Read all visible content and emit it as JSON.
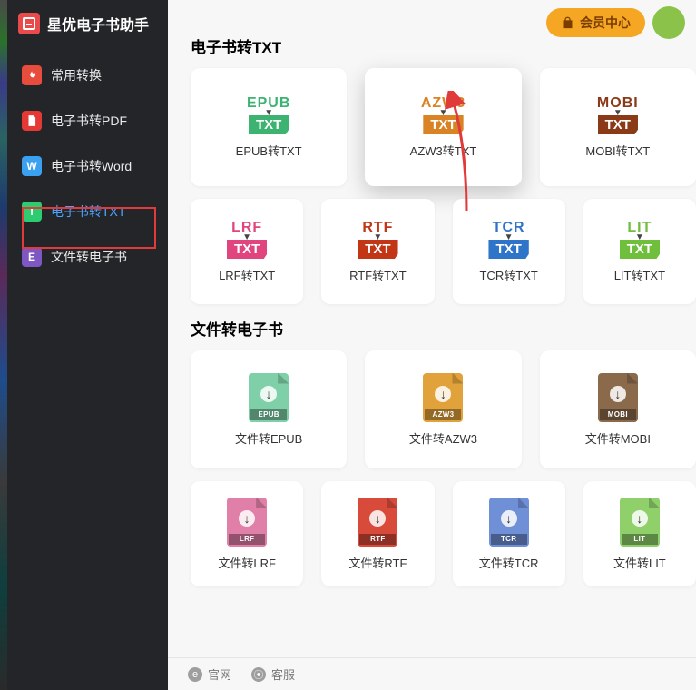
{
  "app_title": "星优电子书助手",
  "header": {
    "vip_label": "会员中心"
  },
  "sidebar": {
    "items": [
      {
        "label": "常用转换"
      },
      {
        "label": "电子书转PDF"
      },
      {
        "label": "电子书转Word"
      },
      {
        "label": "电子书转TXT"
      },
      {
        "label": "文件转电子书"
      }
    ]
  },
  "sections": [
    {
      "title": "电子书转TXT",
      "rows": [
        [
          {
            "src": "EPUB",
            "color": "#3cb371",
            "label": "EPUB转TXT",
            "big": true
          },
          {
            "src": "AZW3",
            "color": "#d98324",
            "label": "AZW3转TXT",
            "big": true,
            "hi": true
          },
          {
            "src": "MOBI",
            "color": "#8a3a17",
            "label": "MOBI转TXT",
            "big": true
          }
        ],
        [
          {
            "src": "LRF",
            "color": "#e0457e",
            "label": "LRF转TXT"
          },
          {
            "src": "RTF",
            "color": "#c23616",
            "label": "RTF转TXT"
          },
          {
            "src": "TCR",
            "color": "#2e75c9",
            "label": "TCR转TXT"
          },
          {
            "src": "LIT",
            "color": "#6fbf3c",
            "label": "LIT转TXT"
          }
        ]
      ]
    },
    {
      "title": "文件转电子书",
      "rows": [
        [
          {
            "doc": "EPUB",
            "color": "#7fcfa8",
            "label": "文件转EPUB",
            "big": true
          },
          {
            "doc": "AZW3",
            "color": "#e2a23b",
            "label": "文件转AZW3",
            "big": true
          },
          {
            "doc": "MOBI",
            "color": "#8a6a4b",
            "label": "文件转MOBI",
            "big": true
          }
        ],
        [
          {
            "doc": "LRF",
            "color": "#e07fa8",
            "label": "文件转LRF"
          },
          {
            "doc": "RTF",
            "color": "#d84b3a",
            "label": "文件转RTF"
          },
          {
            "doc": "TCR",
            "color": "#6f8fd6",
            "label": "文件转TCR"
          },
          {
            "doc": "LIT",
            "color": "#8fd06a",
            "label": "文件转LIT"
          }
        ]
      ]
    }
  ],
  "footer": {
    "site": "官网",
    "support": "客服"
  }
}
